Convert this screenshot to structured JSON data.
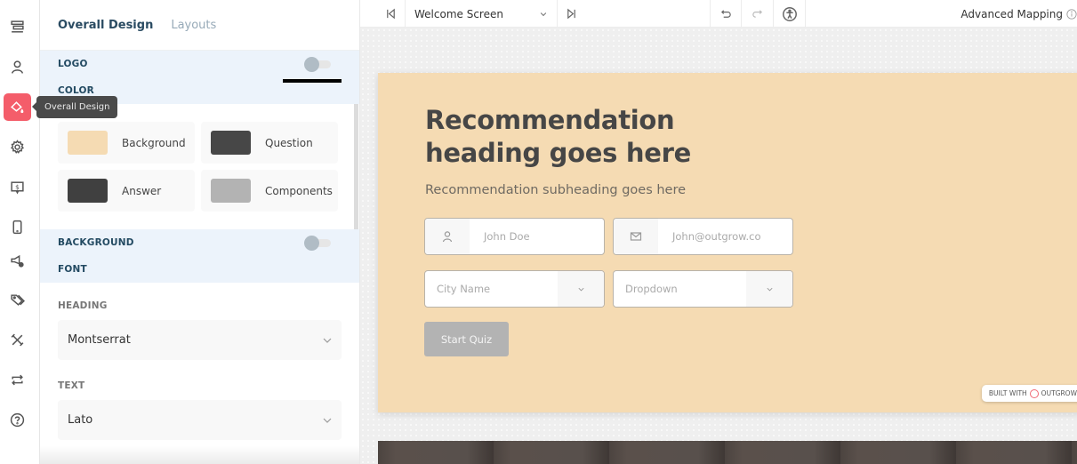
{
  "rail": {
    "items": [
      {
        "icon": "content-icon",
        "label": "Content"
      },
      {
        "icon": "user-icon",
        "label": "Lead Generation"
      },
      {
        "icon": "paint-bucket-icon",
        "label": "Overall Design",
        "active": true
      },
      {
        "icon": "gear-icon",
        "label": "Settings"
      },
      {
        "icon": "monetize-icon",
        "label": "Monetize"
      },
      {
        "icon": "mobile-icon",
        "label": "Mobile"
      },
      {
        "icon": "megaphone-gear-icon",
        "label": "Promotion"
      },
      {
        "icon": "tag-icon",
        "label": "Tags"
      },
      {
        "icon": "tools-icon",
        "label": "Tools"
      },
      {
        "icon": "repeat-icon",
        "label": "Integrations"
      },
      {
        "icon": "help-icon",
        "label": "Help"
      }
    ],
    "tooltip": "Overall Design"
  },
  "panel": {
    "tabs": [
      {
        "label": "Overall Design",
        "active": true
      },
      {
        "label": "Layouts",
        "active": false
      }
    ],
    "logo_label": "LOGO",
    "logo_toggle": false,
    "color_label": "COLOR",
    "colors": [
      {
        "label": "Background",
        "value": "#f5dbb3"
      },
      {
        "label": "Question",
        "value": "#474747"
      },
      {
        "label": "Answer",
        "value": "#404040"
      },
      {
        "label": "Components",
        "value": "#b3b3b3"
      }
    ],
    "background_label": "BACKGROUND",
    "background_toggle": false,
    "font_label": "FONT",
    "heading_label": "HEADING",
    "heading_font": "Montserrat",
    "text_label": "TEXT",
    "text_font": "Lato"
  },
  "toolbar": {
    "screen": "Welcome Screen",
    "advanced_mapping": "Advanced Mapping"
  },
  "preview": {
    "heading": "Recommendation heading goes here",
    "subheading": "Recommendation subheading goes here",
    "name_placeholder": "John Doe",
    "email_placeholder": "John@outgrow.co",
    "city_placeholder": "City Name",
    "dropdown_placeholder": "Dropdown",
    "start_button": "Start Quiz",
    "built_with": "BUILT WITH",
    "brand": "OUTGROW"
  }
}
